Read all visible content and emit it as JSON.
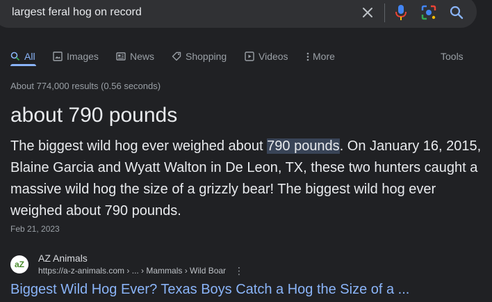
{
  "search": {
    "query": "largest feral hog on record",
    "icons": [
      "close-icon",
      "microphone-icon",
      "lens-icon",
      "search-icon"
    ]
  },
  "tabs": [
    {
      "label": "All",
      "icon": "search-icon",
      "active": true
    },
    {
      "label": "Images",
      "icon": "image-icon"
    },
    {
      "label": "News",
      "icon": "newspaper-icon"
    },
    {
      "label": "Shopping",
      "icon": "tag-icon"
    },
    {
      "label": "Videos",
      "icon": "play-icon"
    },
    {
      "label": "More",
      "icon": "more-vertical-icon"
    }
  ],
  "tools_label": "Tools",
  "result_stats": "About 774,000 results (0.56 seconds)",
  "featured_snippet": {
    "answer": "about 790 pounds",
    "text_before": "The biggest wild hog ever weighed about ",
    "highlight": "790 pounds",
    "text_after": ". On January 16, 2015, Blaine Garcia and Wyatt Walton in De Leon, TX, these two hunters caught a massive wild hog the size of a grizzly bear! The biggest wild hog ever weighed about 790 pounds.",
    "date": "Feb 21, 2023"
  },
  "source": {
    "favicon_text": "aZ",
    "name": "AZ Animals",
    "url": "https://a-z-animals.com › ... › Mammals › Wild Boar",
    "more_icon": "more-vertical-icon",
    "title": "Biggest Wild Hog Ever? Texas Boys Catch a Hog the Size of a ..."
  },
  "colors": {
    "background": "#202124",
    "searchbar": "#303134",
    "link": "#8ab4f8",
    "highlight": "#394457",
    "muted": "#9aa0a6"
  }
}
